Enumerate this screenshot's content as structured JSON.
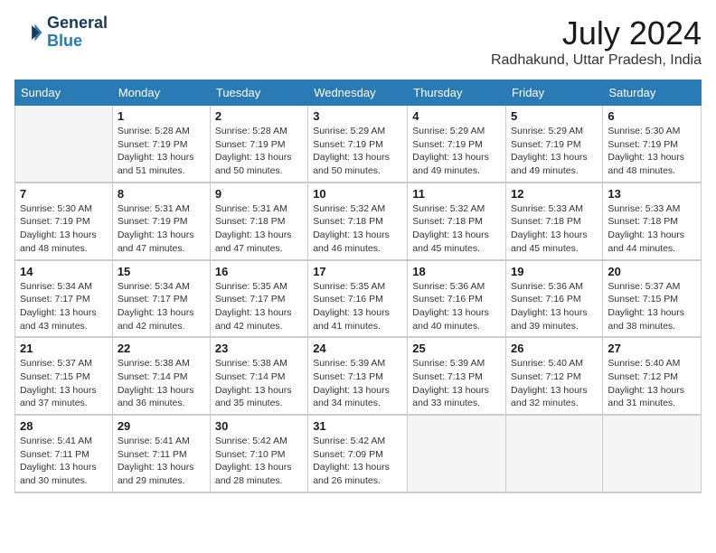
{
  "header": {
    "logo_line1": "General",
    "logo_line2": "Blue",
    "month": "July 2024",
    "location": "Radhakund, Uttar Pradesh, India"
  },
  "weekdays": [
    "Sunday",
    "Monday",
    "Tuesday",
    "Wednesday",
    "Thursday",
    "Friday",
    "Saturday"
  ],
  "weeks": [
    [
      {
        "day": "",
        "info": ""
      },
      {
        "day": "1",
        "info": "Sunrise: 5:28 AM\nSunset: 7:19 PM\nDaylight: 13 hours\nand 51 minutes."
      },
      {
        "day": "2",
        "info": "Sunrise: 5:28 AM\nSunset: 7:19 PM\nDaylight: 13 hours\nand 50 minutes."
      },
      {
        "day": "3",
        "info": "Sunrise: 5:29 AM\nSunset: 7:19 PM\nDaylight: 13 hours\nand 50 minutes."
      },
      {
        "day": "4",
        "info": "Sunrise: 5:29 AM\nSunset: 7:19 PM\nDaylight: 13 hours\nand 49 minutes."
      },
      {
        "day": "5",
        "info": "Sunrise: 5:29 AM\nSunset: 7:19 PM\nDaylight: 13 hours\nand 49 minutes."
      },
      {
        "day": "6",
        "info": "Sunrise: 5:30 AM\nSunset: 7:19 PM\nDaylight: 13 hours\nand 48 minutes."
      }
    ],
    [
      {
        "day": "7",
        "info": "Sunrise: 5:30 AM\nSunset: 7:19 PM\nDaylight: 13 hours\nand 48 minutes."
      },
      {
        "day": "8",
        "info": "Sunrise: 5:31 AM\nSunset: 7:19 PM\nDaylight: 13 hours\nand 47 minutes."
      },
      {
        "day": "9",
        "info": "Sunrise: 5:31 AM\nSunset: 7:18 PM\nDaylight: 13 hours\nand 47 minutes."
      },
      {
        "day": "10",
        "info": "Sunrise: 5:32 AM\nSunset: 7:18 PM\nDaylight: 13 hours\nand 46 minutes."
      },
      {
        "day": "11",
        "info": "Sunrise: 5:32 AM\nSunset: 7:18 PM\nDaylight: 13 hours\nand 45 minutes."
      },
      {
        "day": "12",
        "info": "Sunrise: 5:33 AM\nSunset: 7:18 PM\nDaylight: 13 hours\nand 45 minutes."
      },
      {
        "day": "13",
        "info": "Sunrise: 5:33 AM\nSunset: 7:18 PM\nDaylight: 13 hours\nand 44 minutes."
      }
    ],
    [
      {
        "day": "14",
        "info": "Sunrise: 5:34 AM\nSunset: 7:17 PM\nDaylight: 13 hours\nand 43 minutes."
      },
      {
        "day": "15",
        "info": "Sunrise: 5:34 AM\nSunset: 7:17 PM\nDaylight: 13 hours\nand 42 minutes."
      },
      {
        "day": "16",
        "info": "Sunrise: 5:35 AM\nSunset: 7:17 PM\nDaylight: 13 hours\nand 42 minutes."
      },
      {
        "day": "17",
        "info": "Sunrise: 5:35 AM\nSunset: 7:16 PM\nDaylight: 13 hours\nand 41 minutes."
      },
      {
        "day": "18",
        "info": "Sunrise: 5:36 AM\nSunset: 7:16 PM\nDaylight: 13 hours\nand 40 minutes."
      },
      {
        "day": "19",
        "info": "Sunrise: 5:36 AM\nSunset: 7:16 PM\nDaylight: 13 hours\nand 39 minutes."
      },
      {
        "day": "20",
        "info": "Sunrise: 5:37 AM\nSunset: 7:15 PM\nDaylight: 13 hours\nand 38 minutes."
      }
    ],
    [
      {
        "day": "21",
        "info": "Sunrise: 5:37 AM\nSunset: 7:15 PM\nDaylight: 13 hours\nand 37 minutes."
      },
      {
        "day": "22",
        "info": "Sunrise: 5:38 AM\nSunset: 7:14 PM\nDaylight: 13 hours\nand 36 minutes."
      },
      {
        "day": "23",
        "info": "Sunrise: 5:38 AM\nSunset: 7:14 PM\nDaylight: 13 hours\nand 35 minutes."
      },
      {
        "day": "24",
        "info": "Sunrise: 5:39 AM\nSunset: 7:13 PM\nDaylight: 13 hours\nand 34 minutes."
      },
      {
        "day": "25",
        "info": "Sunrise: 5:39 AM\nSunset: 7:13 PM\nDaylight: 13 hours\nand 33 minutes."
      },
      {
        "day": "26",
        "info": "Sunrise: 5:40 AM\nSunset: 7:12 PM\nDaylight: 13 hours\nand 32 minutes."
      },
      {
        "day": "27",
        "info": "Sunrise: 5:40 AM\nSunset: 7:12 PM\nDaylight: 13 hours\nand 31 minutes."
      }
    ],
    [
      {
        "day": "28",
        "info": "Sunrise: 5:41 AM\nSunset: 7:11 PM\nDaylight: 13 hours\nand 30 minutes."
      },
      {
        "day": "29",
        "info": "Sunrise: 5:41 AM\nSunset: 7:11 PM\nDaylight: 13 hours\nand 29 minutes."
      },
      {
        "day": "30",
        "info": "Sunrise: 5:42 AM\nSunset: 7:10 PM\nDaylight: 13 hours\nand 28 minutes."
      },
      {
        "day": "31",
        "info": "Sunrise: 5:42 AM\nSunset: 7:09 PM\nDaylight: 13 hours\nand 26 minutes."
      },
      {
        "day": "",
        "info": ""
      },
      {
        "day": "",
        "info": ""
      },
      {
        "day": "",
        "info": ""
      }
    ]
  ]
}
